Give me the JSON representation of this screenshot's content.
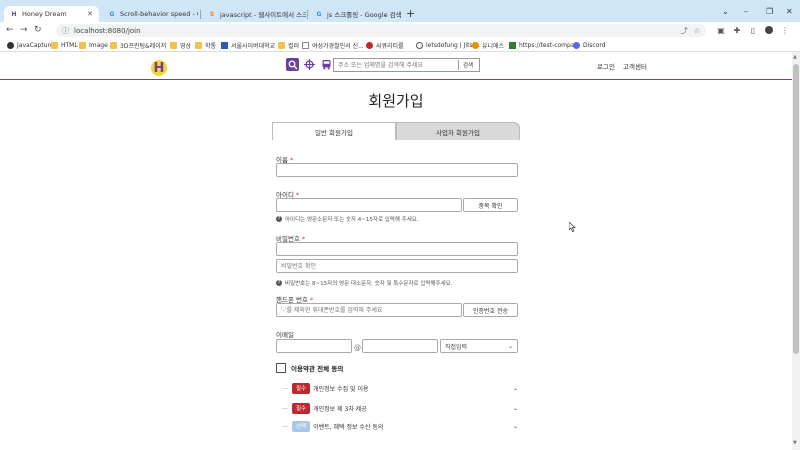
{
  "browser": {
    "tabs": [
      {
        "title": "Honey Dream",
        "favicon": "H",
        "active": true
      },
      {
        "title": "Scroll-behavior speed - Google",
        "favicon": "G",
        "active": false
      },
      {
        "title": "javascript - 웹사이트에서 스크롤",
        "favicon": "S",
        "active": false
      },
      {
        "title": "js 스크롤링 - Google 검색",
        "favicon": "G",
        "active": false
      }
    ],
    "url": "localhost:8080/join",
    "bookmarks": [
      {
        "label": "JavaCapture",
        "icon": "app"
      },
      {
        "label": "HTML",
        "icon": "folder"
      },
      {
        "label": "Image",
        "icon": "folder"
      },
      {
        "label": "3D프린팅&레이저",
        "icon": "folder"
      },
      {
        "label": "영상",
        "icon": "folder"
      },
      {
        "label": "학통",
        "icon": "folder"
      },
      {
        "label": "서울사이버대학교",
        "icon": "app"
      },
      {
        "label": "컬러",
        "icon": "folder"
      },
      {
        "label": "여성가경찰인서 신...",
        "icon": "app"
      },
      {
        "label": "씨큐리티를",
        "icon": "app"
      },
      {
        "label": "letsdofung | Jitsi...",
        "icon": "app"
      },
      {
        "label": "유니에스",
        "icon": "app"
      },
      {
        "label": "https://test-compa...",
        "icon": "app"
      },
      {
        "label": "Discord",
        "icon": "app"
      }
    ]
  },
  "site": {
    "search_placeholder": "주소 또는 업체명을 검색해 주세요",
    "search_button": "검색",
    "login": "로그인",
    "support": "고객센터"
  },
  "form": {
    "title": "회원가입",
    "tab_personal": "일반 회원가입",
    "tab_business": "사업자 회원가입",
    "name_label": "이름",
    "id_label": "아이디",
    "id_check_button": "중복 확인",
    "id_hint": "아이디는 영문소문자 또는 숫자 4~15자로 입력해 주세요.",
    "password_label": "비밀번호",
    "password_confirm_placeholder": "비밀번호 확인",
    "password_hint": "비밀번호는 8~15자의 영문 대소문자, 숫자 및 특수문자로 입력해주세요.",
    "phone_label": "핸드폰 번호",
    "phone_placeholder": "'-'를 제외한 휴대폰번호를 입력해 주세요",
    "phone_button": "인증번호 전송",
    "email_label": "이메일",
    "email_at": "@",
    "email_domain_select": "직접입력",
    "agree_all": "이용약관 전체 동의",
    "terms": [
      {
        "badge": "필수",
        "label": "개인정보 수집 및 이용"
      },
      {
        "badge": "필수",
        "label": "개인정보 제 3자 제공"
      },
      {
        "badge": "선택",
        "label": "이벤트, 혜택 정보 수신 동의"
      }
    ],
    "required_mark": "*"
  },
  "colors": {
    "brand_purple": "#6a3fa0",
    "required_badge": "#c0282c",
    "optional_badge": "#a9c8e8",
    "tab_strip": "#cfe6f7"
  }
}
